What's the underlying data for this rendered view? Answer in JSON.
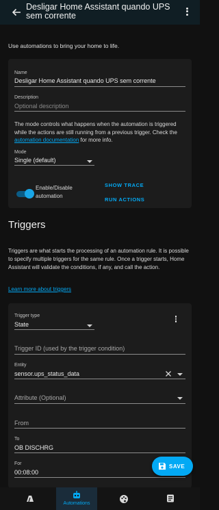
{
  "header": {
    "title": "Desligar Home Assistant quando UPS sem corrente"
  },
  "intro": "Use automations to bring your home to life.",
  "details": {
    "name_label": "Name",
    "name_value": "Desligar Home Assistant quando UPS sem corrente",
    "description_label": "Description",
    "description_placeholder": "Optional description",
    "mode_text_before": "The mode controls what happens when the automation is triggered while the actions are still running from a previous trigger. Check the",
    "mode_link": "automation documentation",
    "mode_text_after": "for more info.",
    "mode_label": "Mode",
    "mode_value": "Single (default)",
    "toggle_label_line1": "Enable/Disable",
    "toggle_label_line2": "automation",
    "toggle_on": true,
    "show_trace": "SHOW TRACE",
    "run_actions": "RUN ACTIONS"
  },
  "triggers": {
    "heading": "Triggers",
    "description": "Triggers are what starts the processing of an automation rule. It is possible to specify multiple triggers for the same rule. Once a trigger starts, Home Assistant will validate the conditions, if any, and call the action.",
    "learn_more": "Learn more about triggers",
    "trigger_type_label": "Trigger type",
    "trigger_type_value": "State",
    "trigger_id_placeholder": "Trigger ID (used by the trigger condition)",
    "entity_label": "Entity",
    "entity_value": "sensor.ups_status_data",
    "attribute_placeholder": "Attribute (Optional)",
    "from_placeholder": "From",
    "to_label": "To",
    "to_value": "OB DISCHRG",
    "for_label": "For",
    "for_value": "00:08:00"
  },
  "fab": {
    "label": "SAVE"
  },
  "bottom_nav": {
    "active_label": "Automations"
  },
  "colors": {
    "accent": "#03a9f4",
    "topbar": "#101e24",
    "card": "#1c1c1c",
    "background": "#111111"
  }
}
